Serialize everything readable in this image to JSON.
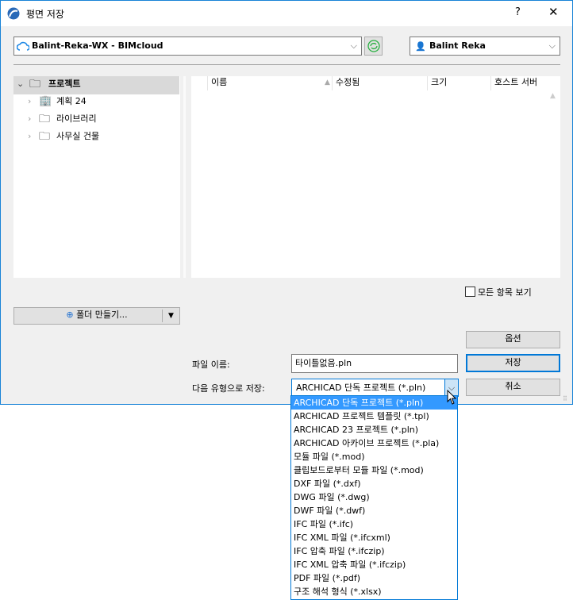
{
  "window": {
    "title": "평면 저장",
    "help": "?",
    "close": "✕"
  },
  "server": {
    "value": "Balint-Reka-WX - BIMcloud"
  },
  "user": {
    "value": "Balint Reka"
  },
  "tree": [
    {
      "label": "프로젝트",
      "icon": "folder-icon",
      "expanded": true
    },
    {
      "label": "계획 24",
      "icon": "building-icon"
    },
    {
      "label": "라이브러리",
      "icon": "library-folder-icon"
    },
    {
      "label": "사무실 건물",
      "icon": "folder-icon"
    }
  ],
  "list": {
    "columns": [
      "이름",
      "수정됨",
      "크기",
      "호스트 서버"
    ]
  },
  "show_all": {
    "label": "모든 항목 보기",
    "checked": false
  },
  "new_folder": {
    "label": "폴더 만들기..."
  },
  "buttons": {
    "options": "옵션",
    "save": "저장",
    "cancel": "취소"
  },
  "filename": {
    "label": "파일 이름:",
    "value": "타이틀없음.pln"
  },
  "filetype": {
    "label": "다음 유형으로 저장:",
    "value": "ARCHICAD 단독 프로젝트 (*.pln)",
    "options": [
      "ARCHICAD 단독 프로젝트 (*.pln)",
      "ARCHICAD 프로젝트 템플릿 (*.tpl)",
      "ARCHICAD 23 프로젝트 (*.pln)",
      "ARCHICAD 아카이브 프로젝트 (*.pla)",
      "모듈 파일 (*.mod)",
      "클립보드로부터 모듈 파일 (*.mod)",
      "DXF 파일 (*.dxf)",
      "DWG 파일 (*.dwg)",
      "DWF 파일 (*.dwf)",
      "IFC 파일 (*.ifc)",
      "IFC XML 파일 (*.ifcxml)",
      "IFC 압축 파일 (*.ifczip)",
      "IFC XML 압축 파일 (*.ifczip)",
      "PDF 파일 (*.pdf)",
      "구조 해석 형식 (*.xlsx)"
    ],
    "selected_index": 0
  }
}
